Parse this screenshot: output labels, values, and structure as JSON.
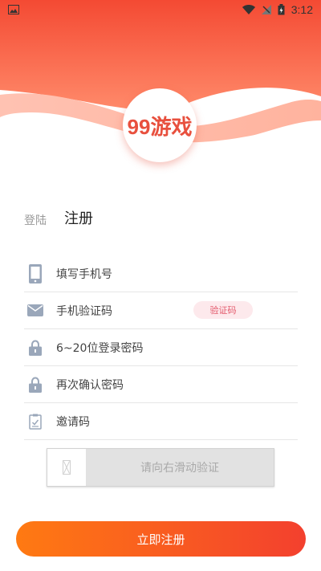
{
  "status_bar": {
    "time": "3:12",
    "icons": [
      "image-icon",
      "wifi-icon",
      "signal-icon",
      "battery-charging-icon"
    ]
  },
  "logo": {
    "text": "99游戏"
  },
  "tabs": {
    "login": "登陆",
    "register": "注册"
  },
  "form": {
    "phone_placeholder": "填写手机号",
    "sms_code_placeholder": "手机验证码",
    "get_code_button": "验证码",
    "password_placeholder": "6~20位登录密码",
    "confirm_password_placeholder": "再次确认密码",
    "invite_code_placeholder": "邀请码"
  },
  "slider": {
    "label": "请向右滑动验证"
  },
  "submit_label": "立即注册",
  "colors": {
    "brand_red": "#e8503e",
    "gradient_start": "#ff7a12",
    "gradient_end": "#f3402e",
    "icon_gray": "#9aa7ba"
  }
}
